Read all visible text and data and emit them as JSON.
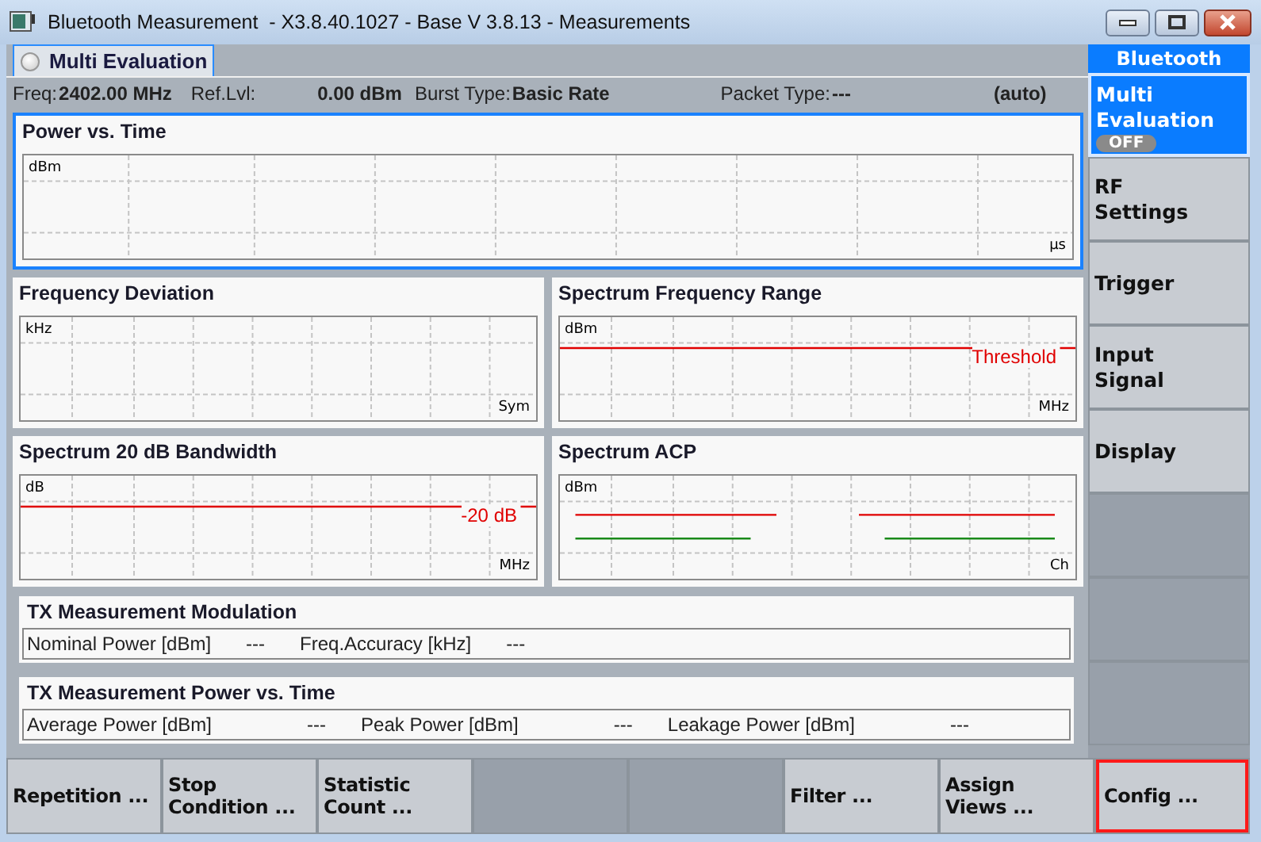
{
  "window": {
    "title": "Bluetooth Measurement  - X3.8.40.1027 - Base V 3.8.13 - Measurements"
  },
  "tab": {
    "label": "Multi Evaluation"
  },
  "info_bar": [
    {
      "label": "Freq:",
      "value": "2402.00 MHz"
    },
    {
      "label": "Ref.Lvl:",
      "value": "0.00 dBm"
    },
    {
      "label": "Burst Type:",
      "value": "Basic Rate"
    },
    {
      "label": "Packet Type:",
      "value": "---"
    },
    {
      "value": "(auto)"
    }
  ],
  "diagrams": [
    {
      "title": "Power vs. Time",
      "kind": "plain",
      "selected": true,
      "y_unit": "dBm",
      "x_unit": "µs"
    },
    {
      "title": "Frequency Deviation",
      "kind": "plain",
      "selected": false,
      "y_unit": "kHz",
      "x_unit": "Sym"
    },
    {
      "title": "Spectrum Frequency Range",
      "kind": "threshold",
      "selected": false,
      "y_unit": "dBm",
      "x_unit": "MHz",
      "marker_label": "Threshold"
    },
    {
      "title": "Spectrum 20 dB Bandwidth",
      "kind": "threshold",
      "selected": false,
      "y_unit": "dB",
      "x_unit": "MHz",
      "marker_label": "-20 dB"
    },
    {
      "title": "Spectrum ACP",
      "kind": "acp",
      "selected": false,
      "y_unit": "dBm",
      "x_unit": "Ch"
    }
  ],
  "result_tables": [
    {
      "title": "TX Measurement Modulation",
      "cells": [
        {
          "label": "Nominal Power [dBm]",
          "value": "---"
        },
        {
          "label": "Freq.Accuracy [kHz]",
          "value": "---"
        }
      ]
    },
    {
      "title": "TX Measurement Power vs. Time",
      "cells": [
        {
          "label": "Average Power [dBm]",
          "value": "---"
        },
        {
          "label": "Peak Power [dBm]",
          "value": "---"
        },
        {
          "label": "Leakage Power [dBm]",
          "value": "---"
        }
      ]
    }
  ],
  "softkeys": {
    "header": "Bluetooth",
    "items": [
      {
        "lines": [
          "Multi",
          "Evaluation"
        ],
        "selected": true,
        "badge": "OFF"
      },
      {
        "lines": [
          "RF",
          "Settings"
        ],
        "selected": false
      },
      {
        "lines": [
          "Trigger"
        ],
        "selected": false
      },
      {
        "lines": [
          "Input",
          "Signal"
        ],
        "selected": false
      },
      {
        "lines": [
          "Display"
        ],
        "selected": false
      }
    ]
  },
  "hotkeys": [
    {
      "kind": "button",
      "lines": [
        "Repetition ..."
      ],
      "highlighted": false
    },
    {
      "kind": "button",
      "lines": [
        "Stop",
        "Condition ..."
      ],
      "highlighted": false
    },
    {
      "kind": "button",
      "lines": [
        "Statistic",
        "Count ..."
      ],
      "highlighted": false
    },
    {
      "kind": "blank"
    },
    {
      "kind": "blank"
    },
    {
      "kind": "button",
      "lines": [
        "Filter ..."
      ],
      "highlighted": false
    },
    {
      "kind": "button",
      "lines": [
        "Assign",
        "Views ..."
      ],
      "highlighted": false
    },
    {
      "kind": "button",
      "lines": [
        "Config ..."
      ],
      "highlighted": true
    }
  ]
}
